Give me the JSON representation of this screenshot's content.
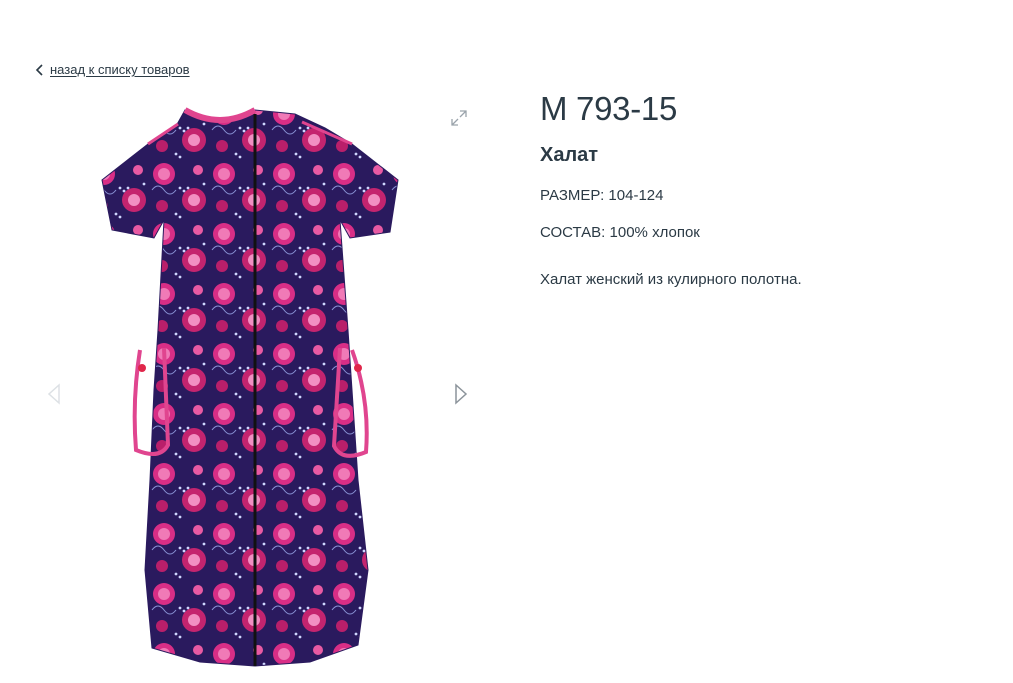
{
  "nav": {
    "back_label": "назад к списку товаров"
  },
  "product": {
    "sku": "М 793-15",
    "name": "Халат",
    "size_label": "РАЗМЕР:",
    "size_value": "104-124",
    "composition_label": "СОСТАВ:",
    "composition_value": "100% хлопок",
    "description": "Халат женский из кулирного полотна."
  },
  "gallery": {
    "image_subject": "floral-print-robe",
    "icons": {
      "expand": "expand-icon",
      "prev": "arrow-left-icon",
      "next": "arrow-right-icon"
    }
  },
  "colors": {
    "text": "#2b3a45",
    "robe_base": "#2a1a5e",
    "robe_trim": "#e0458f",
    "flower_pink": "#e0338f",
    "flower_light": "#f07ab7"
  }
}
